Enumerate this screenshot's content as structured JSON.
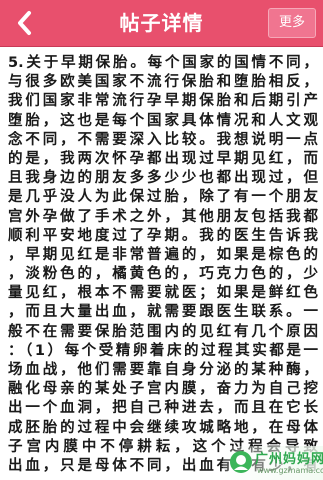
{
  "header": {
    "title": "帖子详情",
    "back_icon": "chevron-left-icon",
    "more_label": "更多",
    "bar_color": "#e8506d"
  },
  "post": {
    "lines": [
      "5.关于早期保胎。每个国家的国情不同，",
      "与很多欧美国家不流行保胎和堕胎相反，",
      "我们国家非常流行孕早期保胎和后期引产",
      "堕胎，这也是每个国家具体情况和人文观",
      "念不同，不需要深入比较。我想说明一点",
      "的是，我两次怀孕都出现过早期见红，而",
      "且我身边的朋友多多少少也都出现过，但",
      "是几乎没人为此保过胎，除了有一个朋友",
      "宫外孕做了手术之外，其他朋友包括我都",
      "顺利平安地度过了孕期。我的医生告诉我",
      "，早期见红是非常普遍的，如果是棕色的",
      "，淡粉色的，橘黄色的，巧克力色的，少",
      "量见红，根本不需要就医；如果是鲜红色",
      "，而且大量出血，就需要跟医生联系。一",
      "般不在需要保胎范围内的见红有几个原因",
      "：（1）每个受精卵着床的过程其实都是一",
      "场血战，他们需要靠自身分泌的某种酶，",
      "融化母亲的某处子宫内膜，奋力为自己挖",
      "出一个血洞，把自己种进去，而且在它长",
      "成胚胎的过程中会继续攻城略地，在母体",
      "子宫内膜中不停耕耘，这个过程会导致",
      "出血，只是母体不同，出血有多有少，有"
    ]
  },
  "watermark": {
    "text": "广州妈妈网",
    "url": "www.gzmama.com",
    "logo_icon": "watermark-logo-icon"
  }
}
